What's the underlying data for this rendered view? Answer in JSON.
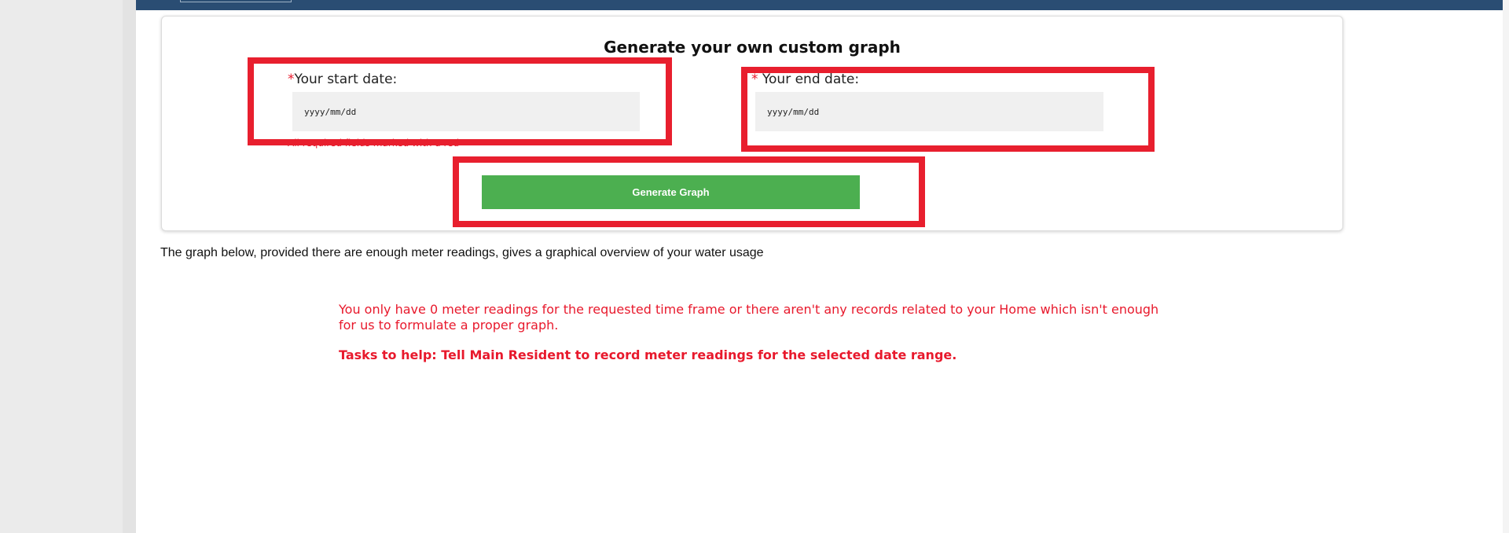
{
  "form": {
    "title": "Generate your own custom graph",
    "required_marker": "*",
    "start_label": "Your start date:",
    "start_placeholder": "yyyy/mm/dd",
    "end_label": " Your end date:",
    "end_placeholder": "yyyy/mm/dd",
    "required_note": "All required fields marked with a red",
    "generate_label": "Generate Graph"
  },
  "content": {
    "description": "The graph below, provided there are enough meter readings, gives a graphical overview of your water usage",
    "warning": "You only have 0 meter readings for the requested time frame or there aren't any records related to your Home which isn't enough for us to formulate a proper graph.",
    "tasks": "Tasks to help: Tell Main Resident to record meter readings for the selected date range."
  },
  "colors": {
    "topbar": "#2a4d73",
    "accent_red": "#e8192c",
    "button_green": "#4caf50",
    "input_bg": "#f0f0f0"
  }
}
